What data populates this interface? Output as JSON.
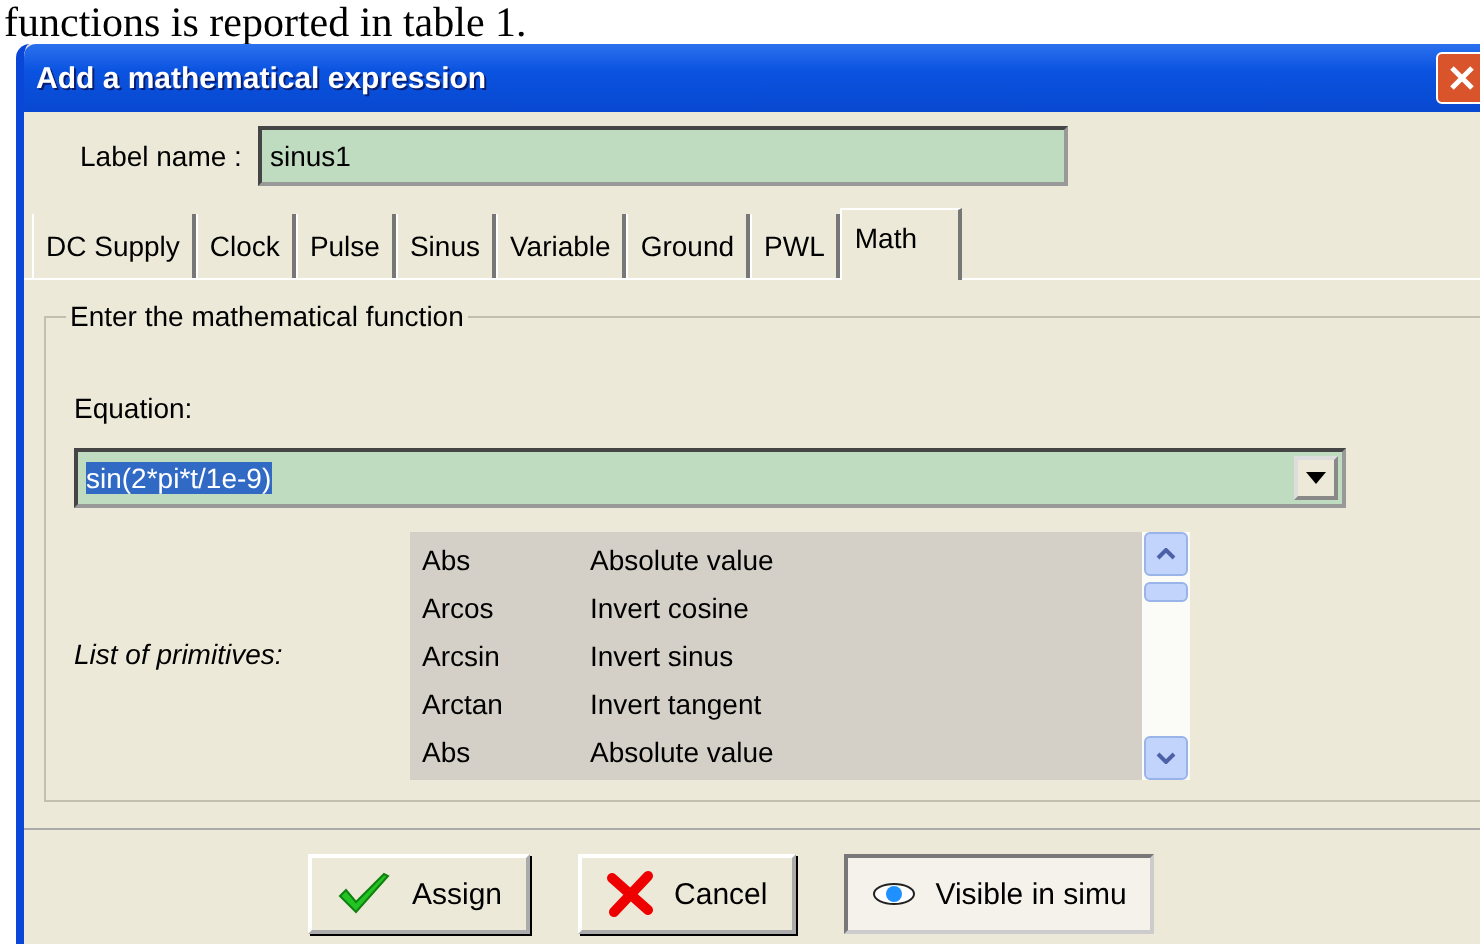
{
  "document_text": "functions is reported in table 1.",
  "window": {
    "title": "Add a mathematical expression"
  },
  "label_name": {
    "label": "Label name :",
    "value": "sinus1"
  },
  "tabs": [
    {
      "label": "DC Supply",
      "selected": false
    },
    {
      "label": "Clock",
      "selected": false
    },
    {
      "label": "Pulse",
      "selected": false
    },
    {
      "label": "Sinus",
      "selected": false
    },
    {
      "label": "Variable",
      "selected": false
    },
    {
      "label": "Ground",
      "selected": false
    },
    {
      "label": "PWL",
      "selected": false
    },
    {
      "label": "Math",
      "selected": true
    }
  ],
  "group": {
    "title": "Enter the mathematical function",
    "equation_label": "Equation:",
    "equation": "sin(2*pi*t/1e-9)",
    "list_label": "List of primitives:",
    "primitives": [
      {
        "name": "Abs",
        "description": "Absolute value"
      },
      {
        "name": "Arcos",
        "description": "Invert cosine"
      },
      {
        "name": "Arcsin",
        "description": "Invert sinus"
      },
      {
        "name": "Arctan",
        "description": "Invert tangent"
      },
      {
        "name": "Abs",
        "description": "Absolute value"
      }
    ]
  },
  "buttons": [
    {
      "label": "Assign",
      "kind": "assign",
      "pressed": false
    },
    {
      "label": "Cancel",
      "kind": "cancel",
      "pressed": false
    },
    {
      "label": "Visible in simu",
      "kind": "eye",
      "pressed": true
    }
  ]
}
